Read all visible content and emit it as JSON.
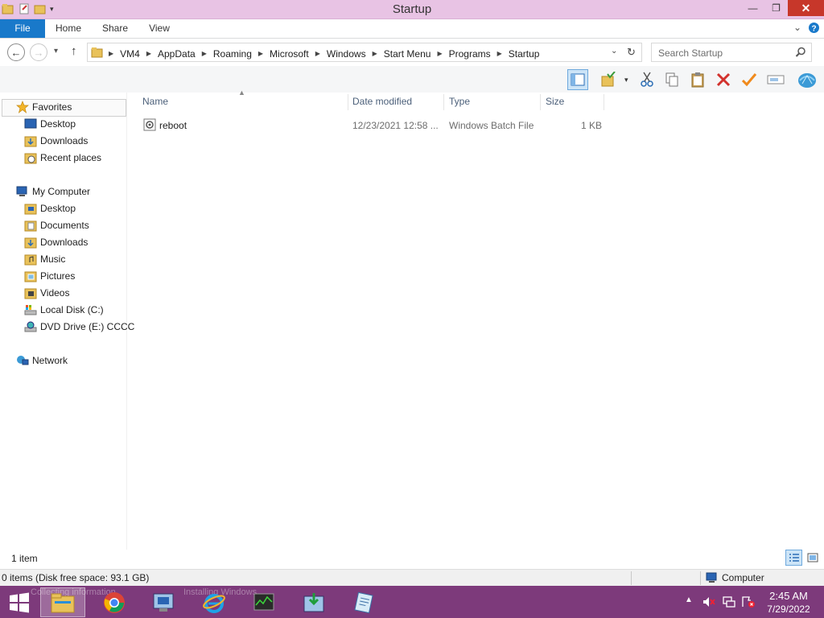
{
  "window": {
    "title": "Startup"
  },
  "ribbon": {
    "tabs": [
      "File",
      "Home",
      "Share",
      "View"
    ]
  },
  "breadcrumbs": [
    "VM4",
    "AppData",
    "Roaming",
    "Microsoft",
    "Windows",
    "Start Menu",
    "Programs",
    "Startup"
  ],
  "search": {
    "placeholder": "Search Startup"
  },
  "columns": {
    "name": "Name",
    "date": "Date modified",
    "type": "Type",
    "size": "Size"
  },
  "files": [
    {
      "name": "reboot",
      "date": "12/23/2021 12:58 ...",
      "type": "Windows Batch File",
      "size": "1 KB"
    }
  ],
  "navigation": {
    "favorites": {
      "label": "Favorites",
      "items": [
        "Desktop",
        "Downloads",
        "Recent places"
      ]
    },
    "computer": {
      "label": "My Computer",
      "items": [
        "Desktop",
        "Documents",
        "Downloads",
        "Music",
        "Pictures",
        "Videos",
        "Local Disk (C:)",
        "DVD Drive (E:) CCCC"
      ]
    },
    "network": {
      "label": "Network"
    }
  },
  "status": {
    "item_count": "1 item",
    "disk_info": "0 items (Disk free space: 93.1 GB)",
    "location": "Computer"
  },
  "taskbar": {
    "ghost_text_1": "Collecting information",
    "ghost_text_2": "Installing Windows",
    "time": "2:45 AM",
    "date": "7/29/2022"
  },
  "colors": {
    "titlebar": "#e8c3e4",
    "file_tab": "#1979ca",
    "taskbar": "#7d3a7b",
    "close": "#c7372a"
  }
}
